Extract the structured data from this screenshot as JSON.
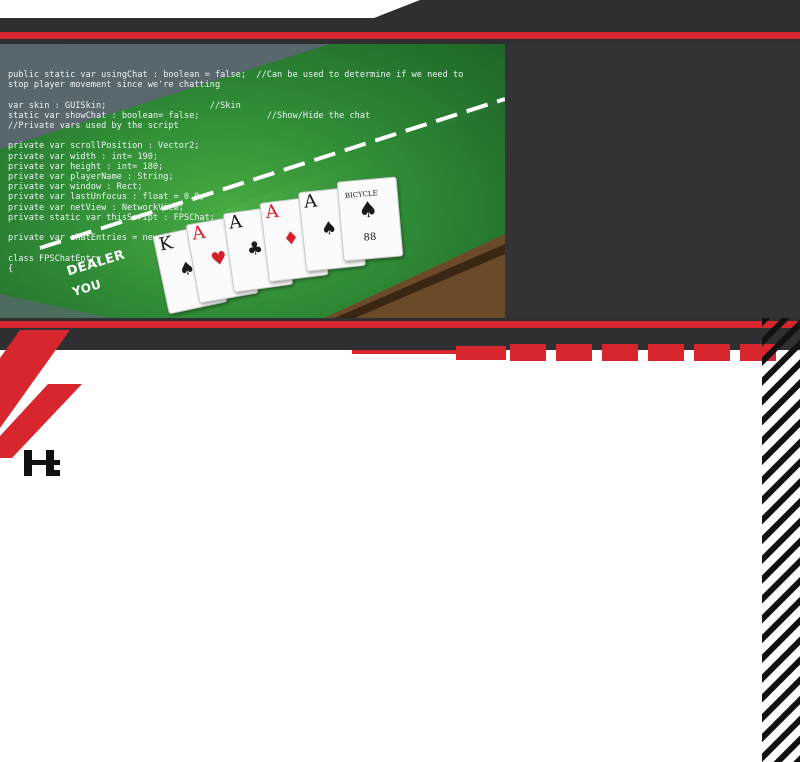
{
  "colors": {
    "accent": "#d8262e",
    "dark": "#2f2f33",
    "felt": "#2f8b36",
    "white": "#ffffff"
  },
  "code_lines": [
    "public static var usingChat : boolean = false;  //Can be used to determine if we need to",
    "stop player movement since we're chatting",
    "",
    "var skin : GUISkin;                    //Skin",
    "static var showChat : boolean= false;             //Show/Hide the chat",
    "//Private vars used by the script",
    "",
    "private var scrollPosition : Vector2;",
    "private var width : int= 190;",
    "private var height : int= 180;",
    "private var playerName : String;",
    "private var window : Rect;",
    "private var lastUnfocus : float = 0.0;",
    "private var netView : NetworkView;",
    "private static var thisScript : FPSChat;",
    "",
    "private var chatEntries = new ArrayList();",
    "",
    "class FPSChatEntry",
    "{"
  ],
  "table_labels": {
    "dealer": "DEALER",
    "you": "YOU"
  },
  "cards": [
    {
      "rank": "K",
      "suit": "♠",
      "color": "black"
    },
    {
      "rank": "A",
      "suit": "♥",
      "color": "red"
    },
    {
      "rank": "A",
      "suit": "♣",
      "color": "black"
    },
    {
      "rank": "A",
      "suit": "♦",
      "color": "red"
    },
    {
      "rank": "A",
      "suit": "♠",
      "color": "black"
    },
    {
      "rank": "88",
      "suit": "♠",
      "color": "black",
      "brand": "BICYCLE"
    }
  ],
  "logo": {
    "text": "JL"
  },
  "icons": {
    "logo": "jl-monogram-icon",
    "stripes": "diagonal-hatch-decoration"
  }
}
